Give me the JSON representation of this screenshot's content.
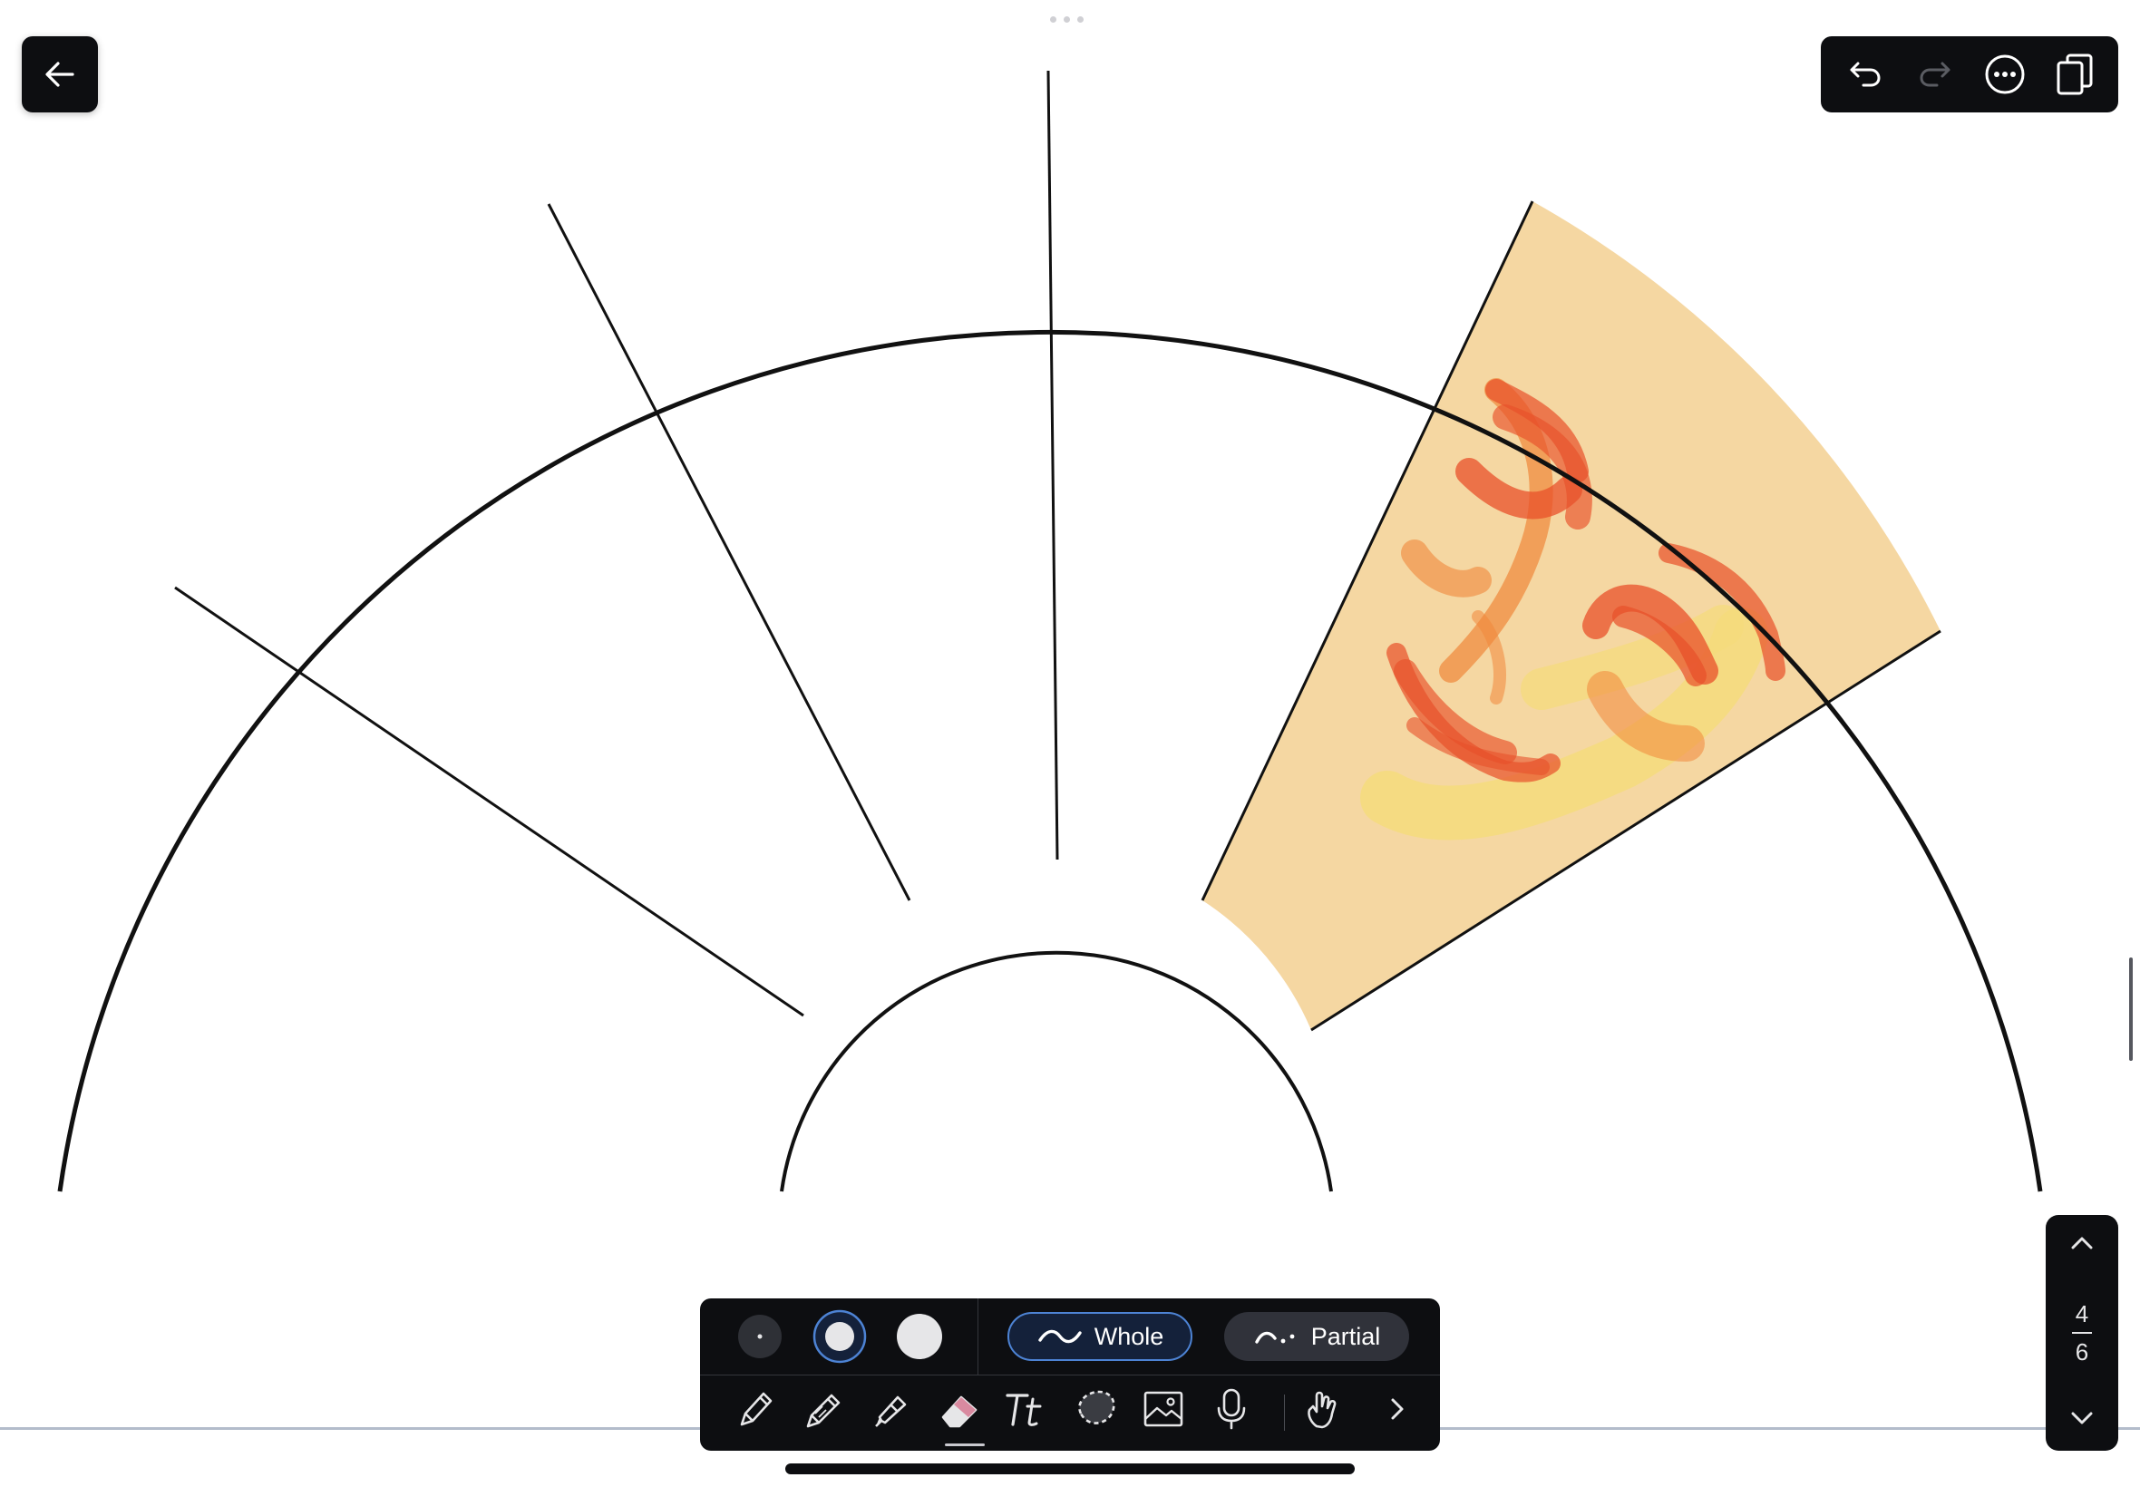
{
  "app": {
    "screen": "note-editor"
  },
  "colors": {
    "highlight_fill": "#f5d7a2",
    "scribble_red": "#e8502a",
    "scribble_orange": "#f0873a",
    "scribble_yellow": "#f5dc7a",
    "toolbar_bg": "#0d0e11",
    "accent_blue": "#4d83d4"
  },
  "canvas": {
    "shape": "semicircular-wheel",
    "segment_count": 6,
    "highlighted_segment": 5
  },
  "top_toolbar": {
    "icons": [
      "back-arrow-icon",
      "undo-icon",
      "redo-icon",
      "more-options-icon",
      "pages-icon"
    ]
  },
  "eraser_panel": {
    "sizes": [
      "small",
      "medium",
      "large"
    ],
    "selected_size": "medium",
    "modes": {
      "whole": "Whole",
      "partial": "Partial"
    },
    "selected_mode": "whole",
    "tools": [
      "pen",
      "pencil",
      "highlighter",
      "eraser",
      "text",
      "lasso",
      "image",
      "microphone",
      "hand",
      "expand"
    ],
    "active_tool": "eraser"
  },
  "page_nav": {
    "current": "4",
    "total": "6"
  }
}
